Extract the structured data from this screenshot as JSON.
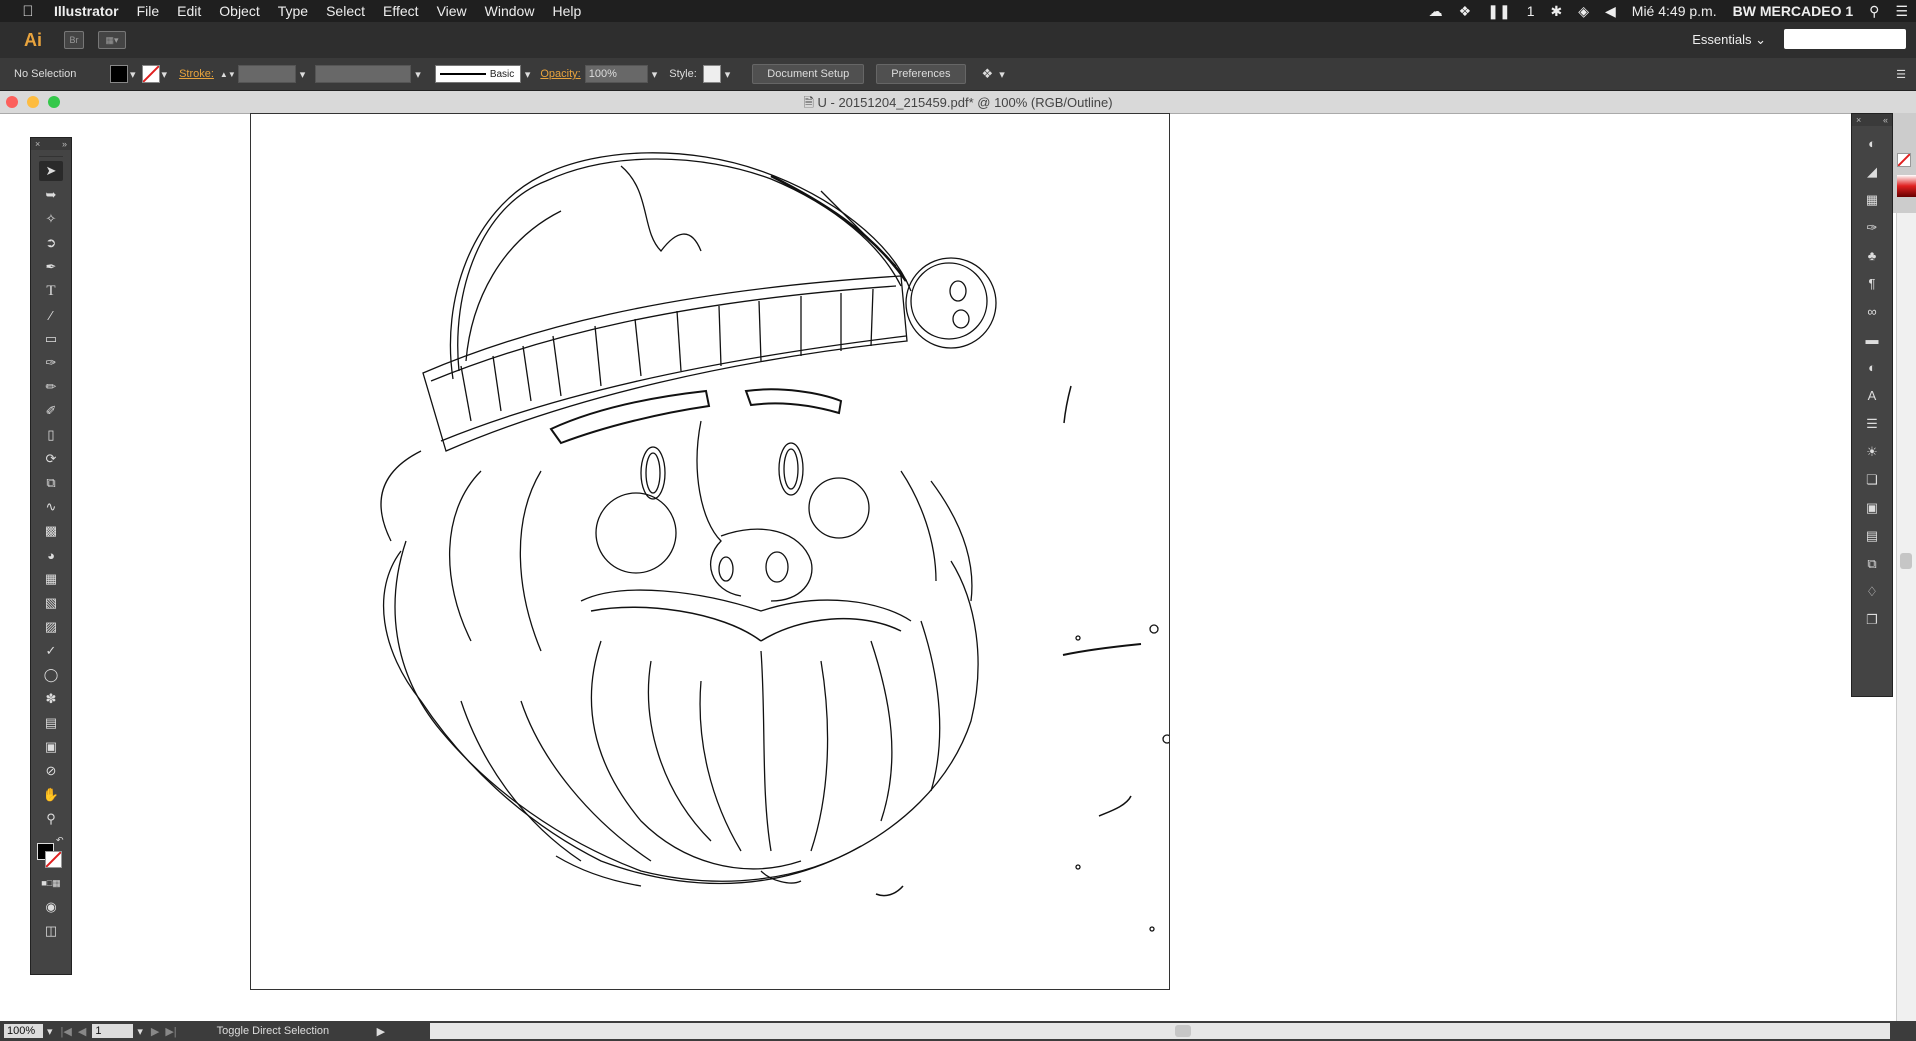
{
  "menubar": {
    "app_name": "Illustrator",
    "menus": [
      "File",
      "Edit",
      "Object",
      "Type",
      "Select",
      "Effect",
      "View",
      "Window",
      "Help"
    ],
    "status_icons": [
      "creative-cloud-icon",
      "dropbox-icon",
      "pause-icon",
      "1",
      "bluetooth-icon",
      "wifi-icon",
      "volume-icon"
    ],
    "clock": "Mié 4:49 p.m.",
    "user": "BW MERCADEO 1"
  },
  "appbar": {
    "logo": "Ai",
    "workspace": "Essentials"
  },
  "control": {
    "selection": "No Selection",
    "stroke_label": "Stroke:",
    "brush_label": "Basic",
    "opacity_label": "Opacity:",
    "opacity_value": "100%",
    "style_label": "Style:",
    "document_setup": "Document Setup",
    "preferences": "Preferences"
  },
  "document": {
    "title": "U - 20151204_215459.pdf* @ 100% (RGB/Outline)"
  },
  "status": {
    "zoom": "100%",
    "page": "1",
    "message": "Toggle Direct Selection"
  },
  "tools": [
    "selection-tool",
    "direct-selection-tool",
    "magic-wand-tool",
    "lasso-tool",
    "pen-tool",
    "type-tool",
    "line-tool",
    "rectangle-tool",
    "paintbrush-tool",
    "pencil-tool",
    "blob-brush-tool",
    "eraser-tool",
    "rotate-tool",
    "scale-tool",
    "warp-tool",
    "free-transform-tool",
    "shape-builder-tool",
    "perspective-grid-tool",
    "mesh-tool",
    "gradient-tool",
    "eyedropper-tool",
    "blend-tool",
    "symbol-sprayer-tool",
    "column-graph-tool",
    "artboard-tool",
    "slice-tool",
    "hand-tool",
    "zoom-tool"
  ],
  "panel_icons": [
    "color-icon",
    "color-guide-icon",
    "swatches-icon",
    "brushes-icon",
    "symbols-icon",
    "paragraph-icon",
    "opentype-icon",
    "gradient-icon",
    "transparency-icon",
    "character-icon",
    "stroke-icon",
    "appearance-icon",
    "graphic-styles-icon",
    "transform-icon",
    "align-icon",
    "pathfinder-icon",
    "layers-icon",
    "artboards-icon"
  ]
}
